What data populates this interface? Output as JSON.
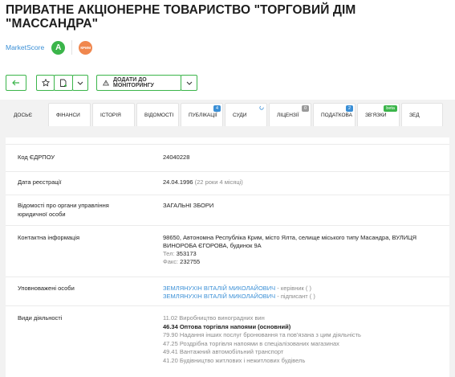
{
  "company": {
    "title": "ПРИВАТНЕ АКЦІОНЕРНЕ ТОВАРИСТВО \"ТОРГОВИЙ ДІМ \"МАССАНДРА\"",
    "marketscore_label": "MarketScore",
    "marketscore_grade": "A",
    "crimea_badge": "КРИМ"
  },
  "toolbar": {
    "monitoring_label": "ДОДАТИ ДО МОНІТОРИНГУ"
  },
  "tabs": [
    {
      "label": "ДОСЬЄ",
      "badge": "",
      "active": true
    },
    {
      "label": "ФІНАНСИ",
      "badge": ""
    },
    {
      "label": "ІСТОРІЯ",
      "badge": ""
    },
    {
      "label": "ВІДОМОСТІ",
      "badge": ""
    },
    {
      "label": "ПУБЛІКАЦІЇ",
      "badge": "4"
    },
    {
      "label": "СУДИ",
      "badge": ""
    },
    {
      "label": "ЛІЦЕНЗІЇ",
      "badge": "0"
    },
    {
      "label": "ПОДАТКОВА",
      "badge": "2"
    },
    {
      "label": "ЗВ'ЯЗКИ",
      "badge": "beta"
    },
    {
      "label": "ЗЕД",
      "badge": ""
    }
  ],
  "colors": {
    "accent_green": "#3bb54a",
    "link_blue": "#3a8fd6",
    "crimea_orange": "#f0874e",
    "badge_blue": "#3a8fd6",
    "badge_gray": "#9a9a9a"
  },
  "details": {
    "edrpou_label": "Код ЄДРПОУ",
    "edrpou_value": "24040228",
    "reg_date_label": "Дата реєстрації",
    "reg_date_value": "24.04.1996",
    "reg_date_age": "(22 роки 4 місяці)",
    "management_label": "Відомості про органи управління юридичної особи",
    "management_value": "ЗАГАЛЬНІ ЗБОРИ",
    "contacts_label": "Контактна інформація",
    "address": "98650, Автономна Республіка Крим, місто Ялта, селище міського типу Масандра, ВУЛИЦЯ ВИНОРОБА ЄГОРОВА, будинок 9А",
    "phone_label": "Тел:",
    "phone_value": "353173",
    "fax_label": "Факс:",
    "fax_value": "232755",
    "authorized_label": "Уповноважені особи",
    "person1_name": "ЗЕМЛЯНУХІН ВІТАЛІЙ МИКОЛАЙОВИЧ",
    "person1_role": "- керівник ( )",
    "person2_name": "ЗЕМЛЯНУХІН ВІТАЛІЙ МИКОЛАЙОВИЧ",
    "person2_role": "- підписант ( )",
    "activities_label": "Види діяльності",
    "activities": [
      "11.02 Виробництво виноградних вин",
      "46.34 Оптова торгівля напоями (основний)",
      "79.90 Надання інших послуг бронювання та пов'язана з цим діяльність",
      "47.25 Роздрібна торгівля напоями в спеціалізованих магазинах",
      "49.41 Вантажний автомобільний транспорт",
      "41.20 Будівництво житлових і нежитлових будівель"
    ]
  }
}
